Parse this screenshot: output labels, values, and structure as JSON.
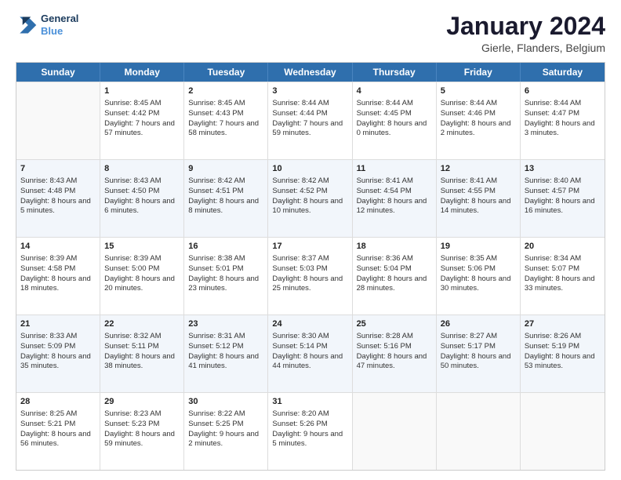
{
  "header": {
    "logo_line1": "General",
    "logo_line2": "Blue",
    "title": "January 2024",
    "subtitle": "Gierle, Flanders, Belgium"
  },
  "calendar": {
    "days_of_week": [
      "Sunday",
      "Monday",
      "Tuesday",
      "Wednesday",
      "Thursday",
      "Friday",
      "Saturday"
    ],
    "rows": [
      [
        {
          "day": "",
          "empty": true
        },
        {
          "day": "1",
          "sunrise": "Sunrise: 8:45 AM",
          "sunset": "Sunset: 4:42 PM",
          "daylight": "Daylight: 7 hours and 57 minutes."
        },
        {
          "day": "2",
          "sunrise": "Sunrise: 8:45 AM",
          "sunset": "Sunset: 4:43 PM",
          "daylight": "Daylight: 7 hours and 58 minutes."
        },
        {
          "day": "3",
          "sunrise": "Sunrise: 8:44 AM",
          "sunset": "Sunset: 4:44 PM",
          "daylight": "Daylight: 7 hours and 59 minutes."
        },
        {
          "day": "4",
          "sunrise": "Sunrise: 8:44 AM",
          "sunset": "Sunset: 4:45 PM",
          "daylight": "Daylight: 8 hours and 0 minutes."
        },
        {
          "day": "5",
          "sunrise": "Sunrise: 8:44 AM",
          "sunset": "Sunset: 4:46 PM",
          "daylight": "Daylight: 8 hours and 2 minutes."
        },
        {
          "day": "6",
          "sunrise": "Sunrise: 8:44 AM",
          "sunset": "Sunset: 4:47 PM",
          "daylight": "Daylight: 8 hours and 3 minutes."
        }
      ],
      [
        {
          "day": "7",
          "sunrise": "Sunrise: 8:43 AM",
          "sunset": "Sunset: 4:48 PM",
          "daylight": "Daylight: 8 hours and 5 minutes."
        },
        {
          "day": "8",
          "sunrise": "Sunrise: 8:43 AM",
          "sunset": "Sunset: 4:50 PM",
          "daylight": "Daylight: 8 hours and 6 minutes."
        },
        {
          "day": "9",
          "sunrise": "Sunrise: 8:42 AM",
          "sunset": "Sunset: 4:51 PM",
          "daylight": "Daylight: 8 hours and 8 minutes."
        },
        {
          "day": "10",
          "sunrise": "Sunrise: 8:42 AM",
          "sunset": "Sunset: 4:52 PM",
          "daylight": "Daylight: 8 hours and 10 minutes."
        },
        {
          "day": "11",
          "sunrise": "Sunrise: 8:41 AM",
          "sunset": "Sunset: 4:54 PM",
          "daylight": "Daylight: 8 hours and 12 minutes."
        },
        {
          "day": "12",
          "sunrise": "Sunrise: 8:41 AM",
          "sunset": "Sunset: 4:55 PM",
          "daylight": "Daylight: 8 hours and 14 minutes."
        },
        {
          "day": "13",
          "sunrise": "Sunrise: 8:40 AM",
          "sunset": "Sunset: 4:57 PM",
          "daylight": "Daylight: 8 hours and 16 minutes."
        }
      ],
      [
        {
          "day": "14",
          "sunrise": "Sunrise: 8:39 AM",
          "sunset": "Sunset: 4:58 PM",
          "daylight": "Daylight: 8 hours and 18 minutes."
        },
        {
          "day": "15",
          "sunrise": "Sunrise: 8:39 AM",
          "sunset": "Sunset: 5:00 PM",
          "daylight": "Daylight: 8 hours and 20 minutes."
        },
        {
          "day": "16",
          "sunrise": "Sunrise: 8:38 AM",
          "sunset": "Sunset: 5:01 PM",
          "daylight": "Daylight: 8 hours and 23 minutes."
        },
        {
          "day": "17",
          "sunrise": "Sunrise: 8:37 AM",
          "sunset": "Sunset: 5:03 PM",
          "daylight": "Daylight: 8 hours and 25 minutes."
        },
        {
          "day": "18",
          "sunrise": "Sunrise: 8:36 AM",
          "sunset": "Sunset: 5:04 PM",
          "daylight": "Daylight: 8 hours and 28 minutes."
        },
        {
          "day": "19",
          "sunrise": "Sunrise: 8:35 AM",
          "sunset": "Sunset: 5:06 PM",
          "daylight": "Daylight: 8 hours and 30 minutes."
        },
        {
          "day": "20",
          "sunrise": "Sunrise: 8:34 AM",
          "sunset": "Sunset: 5:07 PM",
          "daylight": "Daylight: 8 hours and 33 minutes."
        }
      ],
      [
        {
          "day": "21",
          "sunrise": "Sunrise: 8:33 AM",
          "sunset": "Sunset: 5:09 PM",
          "daylight": "Daylight: 8 hours and 35 minutes."
        },
        {
          "day": "22",
          "sunrise": "Sunrise: 8:32 AM",
          "sunset": "Sunset: 5:11 PM",
          "daylight": "Daylight: 8 hours and 38 minutes."
        },
        {
          "day": "23",
          "sunrise": "Sunrise: 8:31 AM",
          "sunset": "Sunset: 5:12 PM",
          "daylight": "Daylight: 8 hours and 41 minutes."
        },
        {
          "day": "24",
          "sunrise": "Sunrise: 8:30 AM",
          "sunset": "Sunset: 5:14 PM",
          "daylight": "Daylight: 8 hours and 44 minutes."
        },
        {
          "day": "25",
          "sunrise": "Sunrise: 8:28 AM",
          "sunset": "Sunset: 5:16 PM",
          "daylight": "Daylight: 8 hours and 47 minutes."
        },
        {
          "day": "26",
          "sunrise": "Sunrise: 8:27 AM",
          "sunset": "Sunset: 5:17 PM",
          "daylight": "Daylight: 8 hours and 50 minutes."
        },
        {
          "day": "27",
          "sunrise": "Sunrise: 8:26 AM",
          "sunset": "Sunset: 5:19 PM",
          "daylight": "Daylight: 8 hours and 53 minutes."
        }
      ],
      [
        {
          "day": "28",
          "sunrise": "Sunrise: 8:25 AM",
          "sunset": "Sunset: 5:21 PM",
          "daylight": "Daylight: 8 hours and 56 minutes."
        },
        {
          "day": "29",
          "sunrise": "Sunrise: 8:23 AM",
          "sunset": "Sunset: 5:23 PM",
          "daylight": "Daylight: 8 hours and 59 minutes."
        },
        {
          "day": "30",
          "sunrise": "Sunrise: 8:22 AM",
          "sunset": "Sunset: 5:25 PM",
          "daylight": "Daylight: 9 hours and 2 minutes."
        },
        {
          "day": "31",
          "sunrise": "Sunrise: 8:20 AM",
          "sunset": "Sunset: 5:26 PM",
          "daylight": "Daylight: 9 hours and 5 minutes."
        },
        {
          "day": "",
          "empty": true
        },
        {
          "day": "",
          "empty": true
        },
        {
          "day": "",
          "empty": true
        }
      ]
    ]
  }
}
